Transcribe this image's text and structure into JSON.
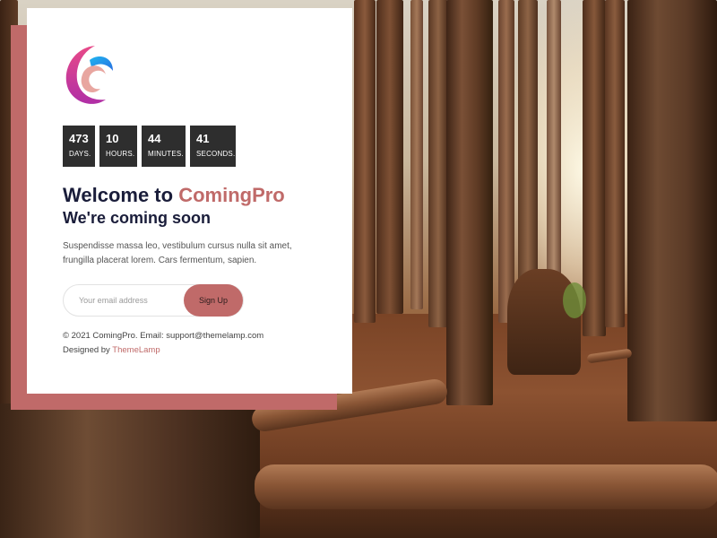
{
  "countdown": [
    {
      "value": "473",
      "label": "DAYS."
    },
    {
      "value": "10",
      "label": "HOURS."
    },
    {
      "value": "44",
      "label": "MINUTES."
    },
    {
      "value": "41",
      "label": "SECONDS."
    }
  ],
  "heading": {
    "prefix": "Welcome to ",
    "brand": "ComingPro"
  },
  "subtitle": "We're coming soon",
  "description": "Suspendisse massa leo, vestibulum cursus nulla sit amet, frungilla placerat lorem. Cars fermentum, sapien.",
  "signup": {
    "email_placeholder": "Your email address",
    "button_label": "Sign Up"
  },
  "footer": {
    "copyright": "© 2021 ComingPro. Email: support@themelamp.com",
    "designed_by_prefix": "Designed by ",
    "designer_link": "ThemeLamp"
  },
  "colors": {
    "accent": "#c06a69",
    "dark": "#1a1d3a",
    "counter_bg": "#2e2e2e"
  },
  "icons": {
    "logo": "comingpro-swirl-logo"
  }
}
